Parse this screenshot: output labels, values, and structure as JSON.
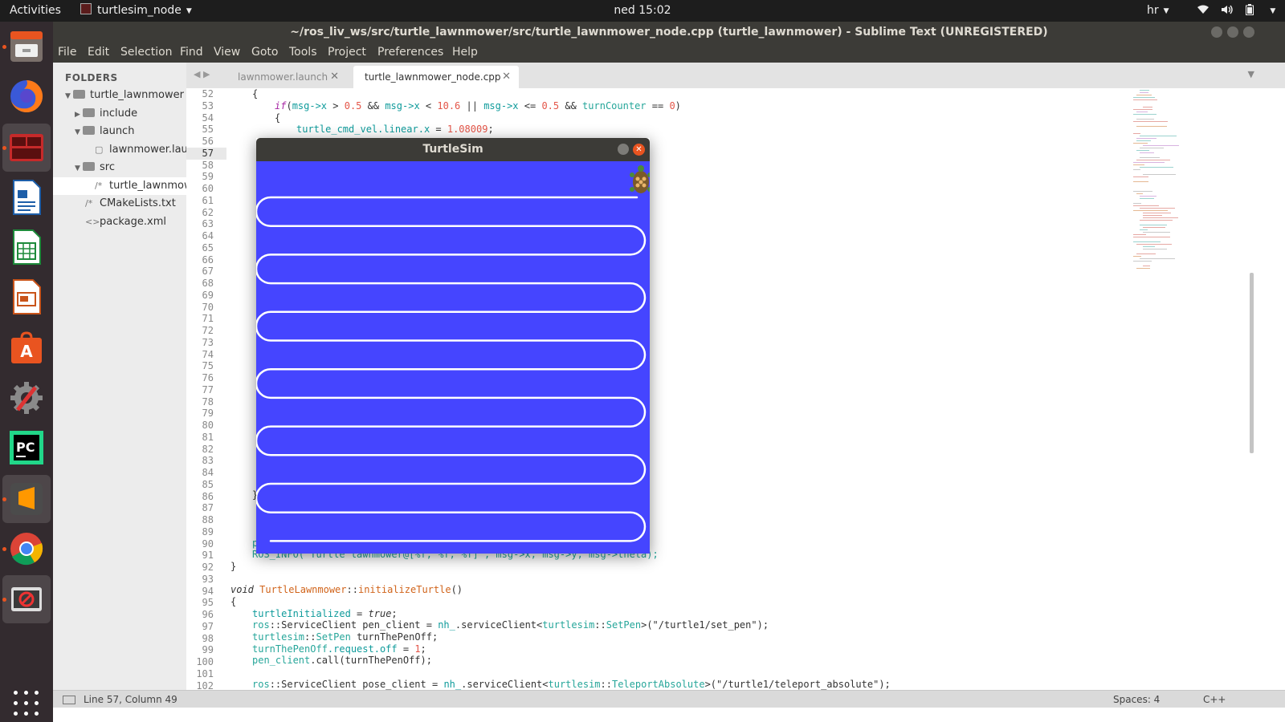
{
  "topbar": {
    "activities": "Activities",
    "app_name": "turtlesim_node",
    "clock": "ned 15:02",
    "language": "hr"
  },
  "dock": {
    "apps": [
      "files",
      "firefox",
      "terminal",
      "libreoffice-writer",
      "libreoffice-calc",
      "libreoffice-impress",
      "ubuntu-software",
      "system-settings",
      "pycharm",
      "sublime-text",
      "chrome",
      "turtlesim"
    ]
  },
  "window": {
    "title": "~/ros_liv_ws/src/turtle_lawnmower/src/turtle_lawnmower_node.cpp (turtle_lawnmower) - Sublime Text (UNREGISTERED)"
  },
  "menu": [
    "File",
    "Edit",
    "Selection",
    "Find",
    "View",
    "Goto",
    "Tools",
    "Project",
    "Preferences",
    "Help"
  ],
  "sidebar": {
    "header": "FOLDERS",
    "items": [
      {
        "label": "turtle_lawnmower"
      },
      {
        "label": "include"
      },
      {
        "label": "launch"
      },
      {
        "label": "lawnmower.launch"
      },
      {
        "label": "src"
      },
      {
        "label": "turtle_lawnmower_node.cpp"
      },
      {
        "label": "CMakeLists.txt"
      },
      {
        "label": "package.xml"
      }
    ]
  },
  "tabs": [
    {
      "label": "lawnmower.launch"
    },
    {
      "label": "turtle_lawnmower_node.cpp"
    }
  ],
  "editor": {
    "line_numbers": [
      "52",
      "53",
      "54",
      "55",
      "56",
      "57",
      "58",
      "59",
      "60",
      "61",
      "62",
      "63",
      "64",
      "65",
      "66",
      "67",
      "68",
      "69",
      "70",
      "71",
      "72",
      "73",
      "74",
      "75",
      "76",
      "77",
      "78",
      "79",
      "80",
      "81",
      "82",
      "83",
      "84",
      "85",
      "86",
      "87",
      "88",
      "89",
      "90",
      "91",
      "92",
      "93",
      "94",
      "95",
      "96",
      "97",
      "98",
      "99",
      "100",
      "101",
      "102"
    ],
    "current_line": "57",
    "code": {
      "l52": "{",
      "l53_kw": "if",
      "l53_rest_a": "(",
      "l53_v1": "msg->x",
      "l53_op1": " > ",
      "l53_n1": "0.5",
      "l53_op2": " && ",
      "l53_v2": "msg->x",
      "l53_op3": " < ",
      "l53_n2": "10.6",
      "l53_op4": " || ",
      "l53_v3": "msg->x",
      "l53_op5": " <= ",
      "l53_n3": "0.5",
      "l53_op6": " && ",
      "l53_v4": "turnCounter",
      "l53_op7": " == ",
      "l53_n4": "0",
      "l53_end": ")",
      "l54": "{",
      "l55_v": "turtle_cmd_vel.linear.x",
      "l55_op": " = ",
      "l55_n": "1.08009",
      "l55_end": ";",
      "l86": "}",
      "l90": "p",
      "l91": "ROS_INFO(\"Turtle lawnmower@[%f, %f, %f]\", msg->x, msg->y, msg->theta);",
      "l92": "}",
      "l94_kw": "void",
      "l94_cls": "TurtleLawnmower",
      "l94_sep": "::",
      "l94_fn": "initializeTurtle",
      "l94_end": "()",
      "l95": "{",
      "l96_v": "turtleInitialized",
      "l96_op": " = ",
      "l96_kw": "true",
      "l96_end": ";",
      "l97_a": "ros",
      "l97_b": "::ServiceClient pen_client = ",
      "l97_c": "nh_",
      "l97_d": ".serviceClient<",
      "l97_e": "turtlesim",
      "l97_f": "::",
      "l97_g": "SetPen",
      "l97_h": ">(\"/turtle1/set_pen\");",
      "l98_a": "turtlesim",
      "l98_b": "::",
      "l98_c": "SetPen",
      "l98_d": " turnThePenOff;",
      "l99_a": "turnThePenOff",
      "l99_b": ".request.off",
      "l99_c": " = ",
      "l99_d": "1",
      "l99_e": ";",
      "l100_a": "pen_client",
      "l100_b": ".call(turnThePenOff);",
      "l102_a": "ros",
      "l102_b": "::ServiceClient pose_client = ",
      "l102_c": "nh_",
      "l102_d": ".serviceClient<",
      "l102_e": "turtlesim",
      "l102_f": "::",
      "l102_g": "TeleportAbsolute",
      "l102_h": ">(\"/turtle1/teleport_absolute\");"
    }
  },
  "statusbar": {
    "position": "Line 57, Column 49",
    "spaces": "Spaces: 4",
    "syntax": "C++"
  },
  "turtlesim": {
    "title": "TurtleSim",
    "background_color": "#4545ff",
    "pen_color": "#ffffff"
  },
  "colors": {
    "ubuntu_orange": "#e95420",
    "titlebar": "#3c3b37",
    "dock": "#332b2f"
  }
}
